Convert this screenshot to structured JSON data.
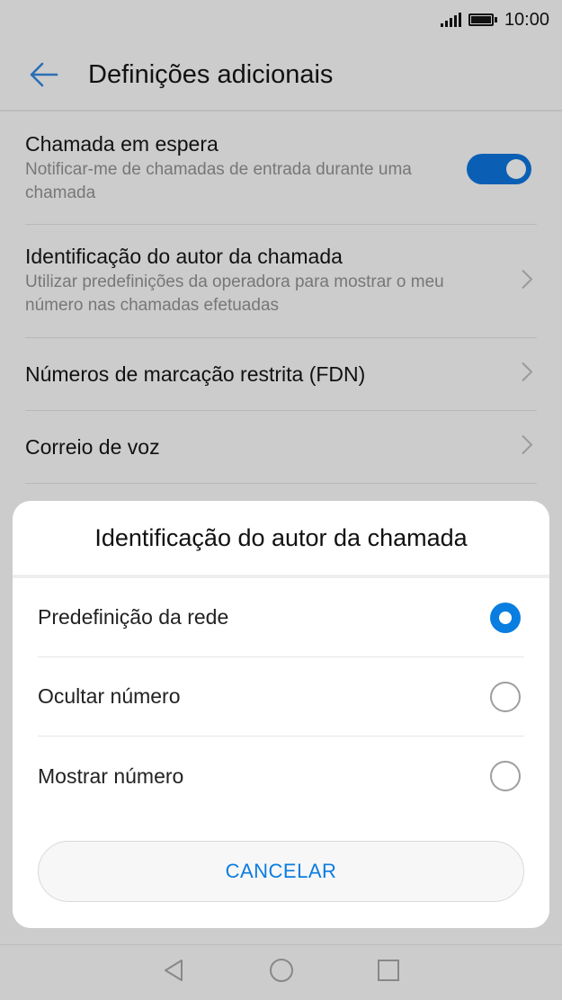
{
  "status_bar": {
    "time": "10:00"
  },
  "app_bar": {
    "title": "Definições adicionais"
  },
  "settings": [
    {
      "title": "Chamada em espera",
      "subtitle": "Notificar-me de chamadas de entrada durante uma chamada",
      "control": "toggle",
      "checked": true
    },
    {
      "title": "Identificação do autor da chamada",
      "subtitle": "Utilizar predefinições da operadora para mostrar o meu número nas chamadas efetuadas",
      "control": "chevron"
    },
    {
      "title": "Números de marcação restrita (FDN)",
      "control": "chevron"
    },
    {
      "title": "Correio de voz",
      "control": "chevron"
    }
  ],
  "dialog": {
    "title": "Identificação do autor da chamada",
    "options": [
      {
        "label": "Predefinição da rede",
        "selected": true
      },
      {
        "label": "Ocultar número",
        "selected": false
      },
      {
        "label": "Mostrar número",
        "selected": false
      }
    ],
    "cancel_label": "CANCELAR"
  },
  "colors": {
    "accent": "#0a7de0",
    "toggle_on": "#0a5fb4",
    "dim_background": "#cccccc"
  },
  "icons": [
    "signal-icon",
    "battery-icon",
    "back-arrow-icon",
    "chevron-right-icon",
    "nav-back-icon",
    "nav-home-icon",
    "nav-recents-icon"
  ]
}
